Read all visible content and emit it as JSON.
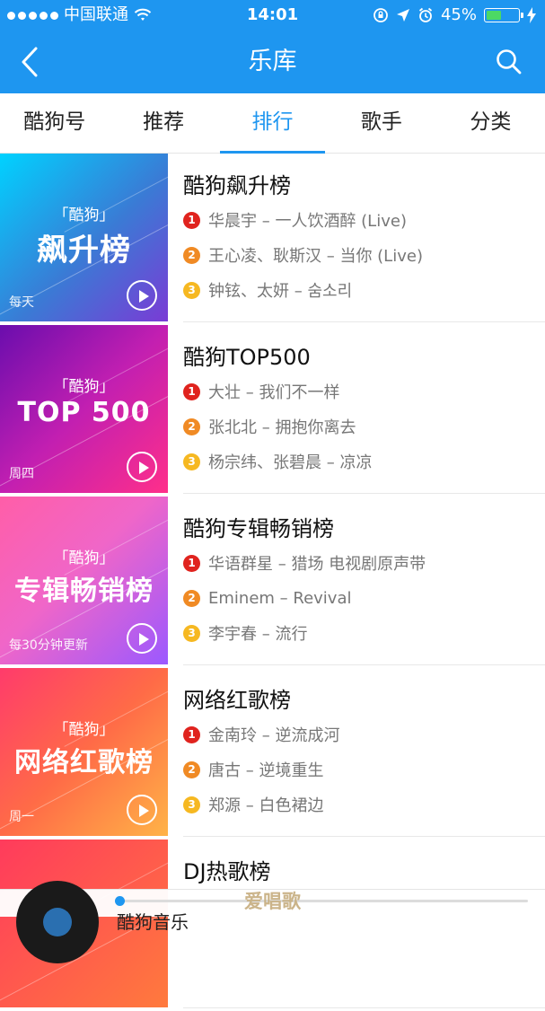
{
  "status": {
    "carrier": "中国联通",
    "time": "14:01",
    "battery": "45%",
    "signal_bars": 5,
    "battery_level": 0.45
  },
  "nav": {
    "title": "乐库"
  },
  "tabs": [
    "酷狗号",
    "推荐",
    "排行",
    "歌手",
    "分类"
  ],
  "active_tab": 2,
  "rankings": [
    {
      "cover_brand": "「酷狗」",
      "cover_title": "飙升榜",
      "cover_freq": "每天",
      "gradient": "g0",
      "title": "酷狗飙升榜",
      "tracks": [
        "华晨宇 – 一人饮酒醉 (Live)",
        "王心凌、耿斯汉 – 当你 (Live)",
        "钟铉、太妍 – 숨소리"
      ]
    },
    {
      "cover_brand": "「酷狗」",
      "cover_title": "TOP 500",
      "cover_freq": "周四",
      "gradient": "g1",
      "title": "酷狗TOP500",
      "tracks": [
        "大壮 – 我们不一样",
        "张北北 – 拥抱你离去",
        "杨宗纬、张碧晨 – 凉凉"
      ]
    },
    {
      "cover_brand": "「酷狗」",
      "cover_title": "专辑畅销榜",
      "cover_freq": "每30分钟更新",
      "gradient": "g2",
      "title": "酷狗专辑畅销榜",
      "tracks": [
        "华语群星 – 猎场 电视剧原声带",
        "Eminem – Revival",
        "李宇春 – 流行"
      ]
    },
    {
      "cover_brand": "「酷狗」",
      "cover_title": "网络红歌榜",
      "cover_freq": "周一",
      "gradient": "g3",
      "title": "网络红歌榜",
      "tracks": [
        "金南玲 – 逆流成河",
        "唐古 – 逆境重生",
        "郑源 – 白色裙边"
      ]
    },
    {
      "cover_brand": "",
      "cover_title": "",
      "cover_freq": "",
      "gradient": "g4",
      "title": "DJ热歌榜",
      "tracks": []
    }
  ],
  "player": {
    "song": "酷狗音乐",
    "progress": 0.0
  },
  "watermark": "爱唱歌",
  "colors": {
    "accent": "#1e96f0",
    "rank1": "#e0231e",
    "rank2": "#f08a24",
    "rank3": "#f6b821"
  }
}
